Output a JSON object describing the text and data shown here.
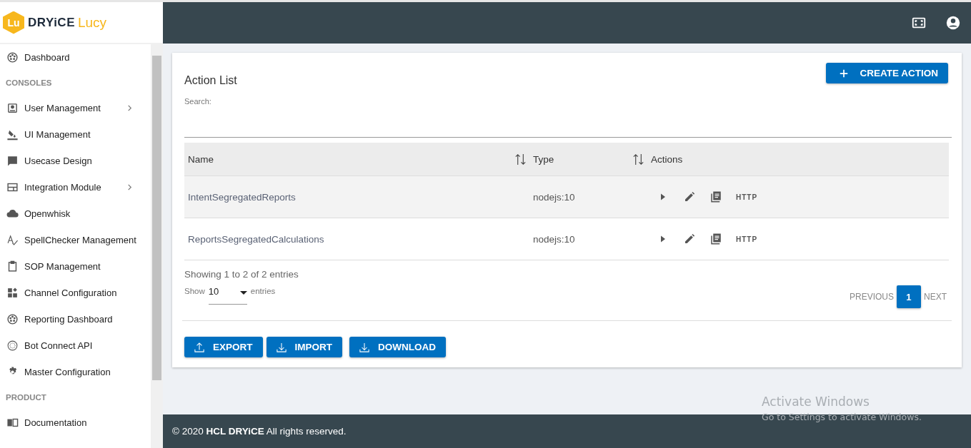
{
  "logo": {
    "badge": "Lu",
    "brand": "DRYiCE",
    "product": "Lucy"
  },
  "sidebar": {
    "items": [
      {
        "kind": "item",
        "label": "Dashboard",
        "has_submenu": false
      },
      {
        "kind": "section",
        "label": "CONSOLES"
      },
      {
        "kind": "item",
        "label": "User Management",
        "has_submenu": true
      },
      {
        "kind": "item",
        "label": "UI Management",
        "has_submenu": false
      },
      {
        "kind": "item",
        "label": "Usecase Design",
        "has_submenu": false
      },
      {
        "kind": "item",
        "label": "Integration Module",
        "has_submenu": true
      },
      {
        "kind": "item",
        "label": "Openwhisk",
        "has_submenu": false
      },
      {
        "kind": "item",
        "label": "SpellChecker Management",
        "has_submenu": false
      },
      {
        "kind": "item",
        "label": "SOP Management",
        "has_submenu": false
      },
      {
        "kind": "item",
        "label": "Channel Configuration",
        "has_submenu": false
      },
      {
        "kind": "item",
        "label": "Reporting Dashboard",
        "has_submenu": false
      },
      {
        "kind": "item",
        "label": "Bot Connect API",
        "has_submenu": false
      },
      {
        "kind": "item",
        "label": "Master Configuration",
        "has_submenu": false
      },
      {
        "kind": "section",
        "label": "PRODUCT"
      },
      {
        "kind": "item",
        "label": "Documentation",
        "has_submenu": false
      }
    ]
  },
  "card": {
    "title": "Action List",
    "create_button": "CREATE ACTION",
    "search": {
      "label": "Search:"
    },
    "table": {
      "columns": [
        {
          "label": "Name",
          "sortable": true
        },
        {
          "label": "Type",
          "sortable": true
        },
        {
          "label": "Actions",
          "sortable": false
        }
      ],
      "rows": [
        {
          "name": "IntentSegregatedReports",
          "type": "nodejs:10",
          "http": "HTTP",
          "highlighted": true
        },
        {
          "name": "ReportsSegregatedCalculations",
          "type": "nodejs:10",
          "http": "HTTP",
          "highlighted": false
        }
      ]
    },
    "info": "Showing 1 to 2 of 2 entries",
    "length": {
      "prefix": "Show",
      "value": "10",
      "suffix": "entries"
    },
    "pagination": {
      "previous": "PREVIOUS",
      "pages": [
        {
          "label": "1",
          "selected": true
        }
      ],
      "next": "NEXT"
    },
    "buttons": [
      {
        "label": "EXPORT",
        "kind": "upload"
      },
      {
        "label": "IMPORT",
        "kind": "download"
      },
      {
        "label": "DOWNLOAD",
        "kind": "download"
      }
    ]
  },
  "footer": "© 2020 **HCL DRYiCE** All rights reserved.",
  "os_notice": {
    "title": "Activate Windows",
    "text": "Go to Settings to activate Windows."
  }
}
